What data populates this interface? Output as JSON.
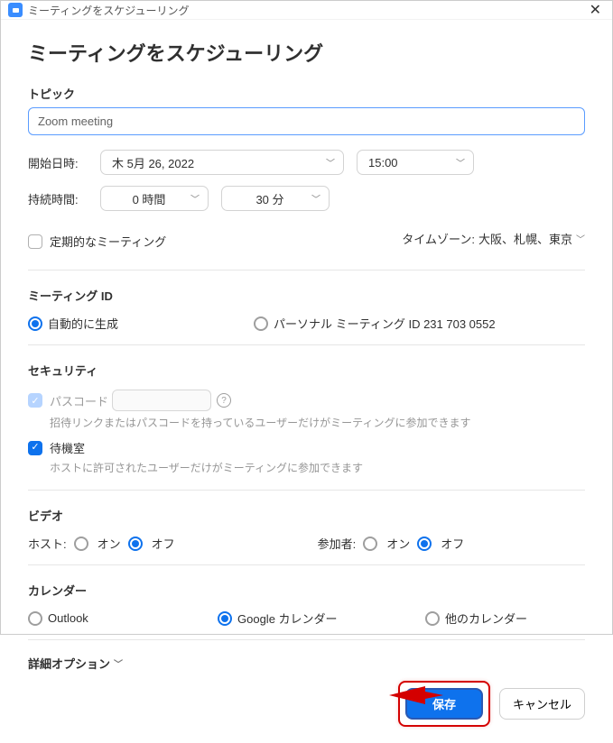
{
  "titlebar": {
    "title": "ミーティングをスケジューリング"
  },
  "page_title": "ミーティングをスケジューリング",
  "topic": {
    "label": "トピック",
    "value": "Zoom meeting"
  },
  "start": {
    "label": "開始日時:",
    "date": "木 5月 26, 2022",
    "time": "15:00"
  },
  "duration": {
    "label": "持続時間:",
    "hours": "0 時間",
    "minutes": "30 分"
  },
  "recurring_label": "定期的なミーティング",
  "timezone": {
    "prefix": "タイムゾーン:",
    "value": "大阪、札幌、東京"
  },
  "meeting_id": {
    "heading": "ミーティング ID",
    "auto": "自動的に生成",
    "personal": "パーソナル ミーティング ID 231 703 0552"
  },
  "security": {
    "heading": "セキュリティ",
    "passcode_label": "パスコード",
    "passcode_desc": "招待リンクまたはパスコードを持っているユーザーだけがミーティングに参加できます",
    "waiting_label": "待機室",
    "waiting_desc": "ホストに許可されたユーザーだけがミーティングに参加できます"
  },
  "video": {
    "heading": "ビデオ",
    "host_label": "ホスト:",
    "participant_label": "参加者:",
    "on": "オン",
    "off": "オフ"
  },
  "calendar": {
    "heading": "カレンダー",
    "outlook": "Outlook",
    "google": "Google カレンダー",
    "other": "他のカレンダー"
  },
  "advanced": "詳細オプション",
  "buttons": {
    "save": "保存",
    "cancel": "キャンセル"
  }
}
